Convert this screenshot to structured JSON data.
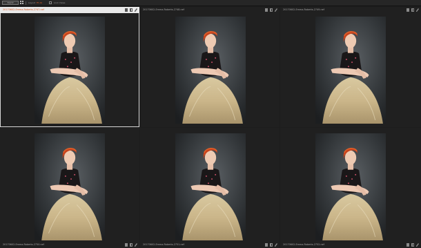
{
  "toolbar": {
    "layout_button": "3×2",
    "chevron": "▾",
    "label_a": "Layout",
    "value_a": "Fit All",
    "label_b": "Lock Views"
  },
  "icons": {
    "grid": "grid-icon",
    "badge": "badge-icon",
    "compare": "compare-icon",
    "edit": "pencil-icon"
  },
  "colors": {
    "selected_filename": "#d6531c",
    "accent": "#e0602a",
    "background": "#1d1d1d"
  },
  "cells": [
    {
      "filename": "20170602-Emma-Roberts-2747.nef",
      "selected": true
    },
    {
      "filename": "20170602-Emma-Roberts-2748.nef",
      "selected": false
    },
    {
      "filename": "20170602-Emma-Roberts-2749.nef",
      "selected": false
    },
    {
      "filename": "20170602-Emma-Roberts-2750.nef",
      "selected": false
    },
    {
      "filename": "20170602-Emma-Roberts-2751.nef",
      "selected": false
    },
    {
      "filename": "20170602-Emma-Roberts-2752.nef",
      "selected": false
    }
  ]
}
